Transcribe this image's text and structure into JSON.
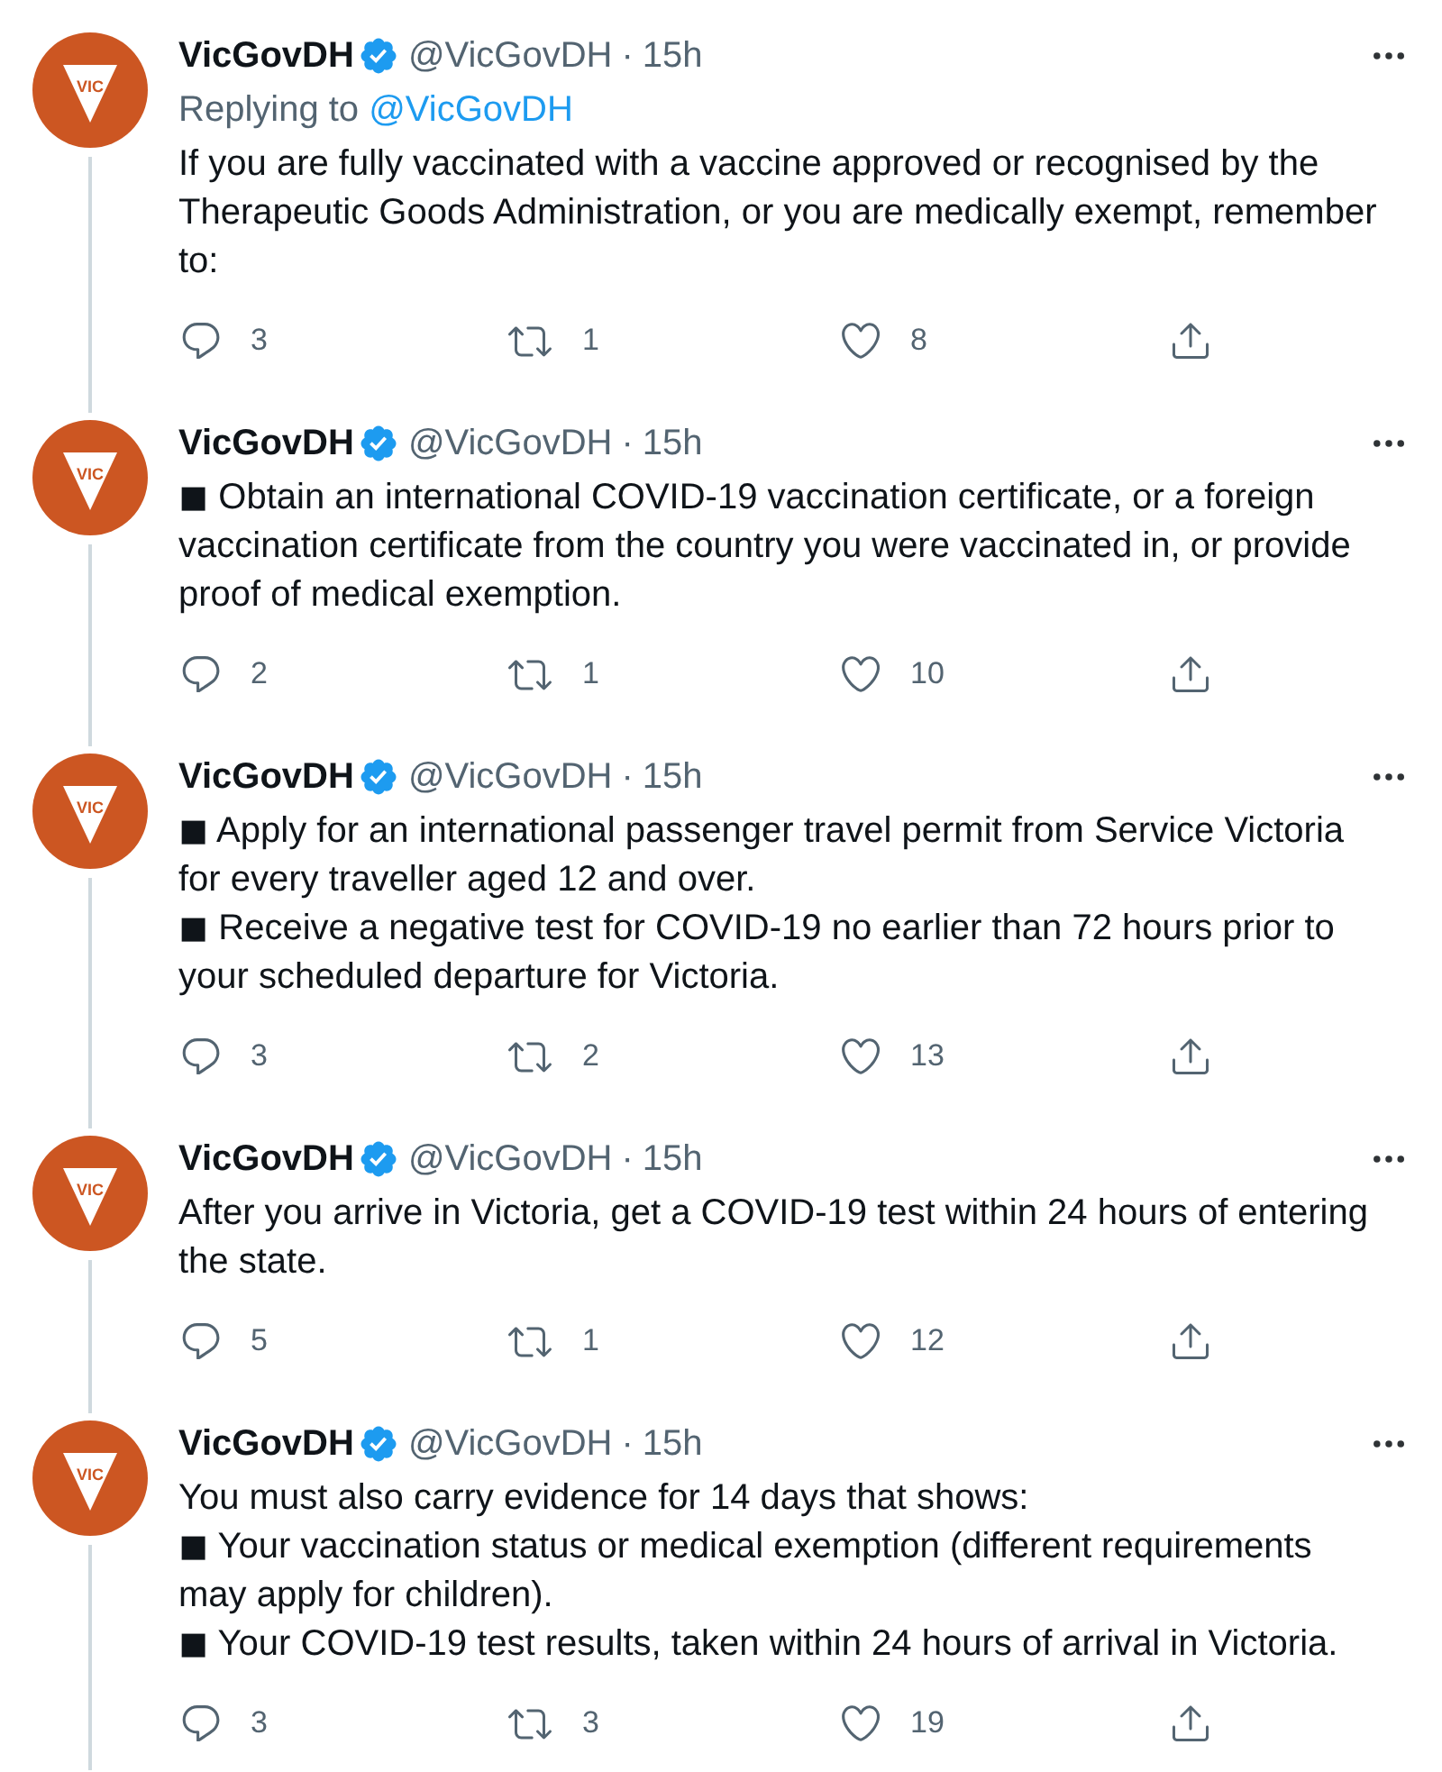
{
  "tweets": [
    {
      "author": {
        "name": "VicGovDH",
        "verified": true,
        "handle": "@VicGovDH",
        "avatar_label": "VIC"
      },
      "separator": "·",
      "time": "15h",
      "reply_to": {
        "label": "Replying to",
        "handle": "@VicGovDH"
      },
      "body": [
        "If you are fully vaccinated with a vaccine approved or recognised by the Therapeutic Goods Administration, or you are medically exempt, remember to:"
      ],
      "stats": {
        "replies": "3",
        "retweets": "1",
        "likes": "8"
      }
    },
    {
      "author": {
        "name": "VicGovDH",
        "verified": true,
        "handle": "@VicGovDH",
        "avatar_label": "VIC"
      },
      "separator": "·",
      "time": "15h",
      "body": [
        "◼ Obtain an international COVID-19 vaccination certificate, or a foreign vaccination certificate from the country you were vaccinated in, or provide proof of medical exemption."
      ],
      "stats": {
        "replies": "2",
        "retweets": "1",
        "likes": "10"
      }
    },
    {
      "author": {
        "name": "VicGovDH",
        "verified": true,
        "handle": "@VicGovDH",
        "avatar_label": "VIC"
      },
      "separator": "·",
      "time": "15h",
      "body": [
        "◼ Apply for an international passenger travel permit from Service Victoria for every traveller aged 12 and over.",
        "◼ Receive a negative test for COVID-19 no earlier than 72 hours prior to your scheduled departure for Victoria."
      ],
      "stats": {
        "replies": "3",
        "retweets": "2",
        "likes": "13"
      }
    },
    {
      "author": {
        "name": "VicGovDH",
        "verified": true,
        "handle": "@VicGovDH",
        "avatar_label": "VIC"
      },
      "separator": "·",
      "time": "15h",
      "body": [
        "After you arrive in Victoria, get a COVID-19 test within 24 hours of entering the state."
      ],
      "stats": {
        "replies": "5",
        "retweets": "1",
        "likes": "12"
      }
    },
    {
      "author": {
        "name": "VicGovDH",
        "verified": true,
        "handle": "@VicGovDH",
        "avatar_label": "VIC"
      },
      "separator": "·",
      "time": "15h",
      "body": [
        "You must also carry evidence for 14 days that shows:",
        "◼ Your vaccination status or medical exemption (different requirements may apply for children).",
        "◼ Your COVID-19 test results, taken within 24 hours of arrival in Victoria."
      ],
      "stats": {
        "replies": "3",
        "retweets": "3",
        "likes": "19"
      }
    }
  ]
}
